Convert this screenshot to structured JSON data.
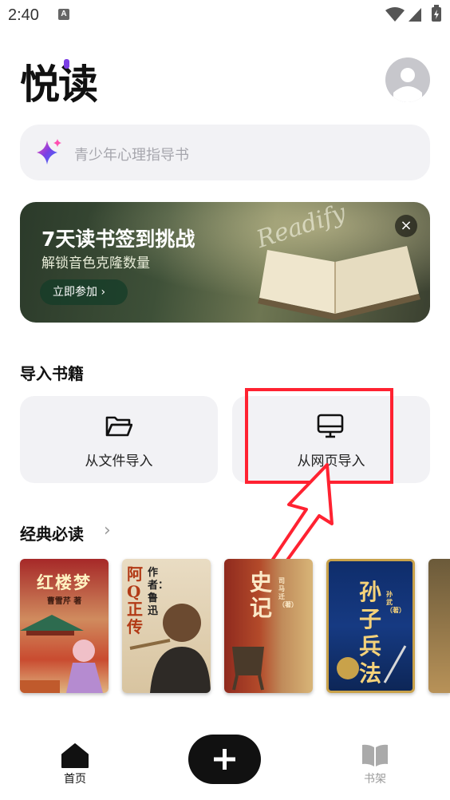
{
  "status_bar": {
    "time": "2:40",
    "notification_icon": "a-letter-icon"
  },
  "header": {
    "logo": "悦读",
    "avatar_icon": "avatar-icon"
  },
  "search": {
    "placeholder": "青少年心理指导书",
    "icon": "sparkle-icon"
  },
  "banner": {
    "title": "7天读书签到挑战",
    "subtitle": "解锁音色克隆数量",
    "button_label": "立即参加 ›",
    "close_label": "×",
    "script_text": "Readify"
  },
  "import": {
    "heading": "导入书籍",
    "file_label": "从文件导入",
    "web_label": "从网页导入"
  },
  "classics": {
    "heading": "经典必读",
    "chevron": "›",
    "books": [
      {
        "title": "红楼梦",
        "author": "曹雪芹 著"
      },
      {
        "title": "阿Q正传",
        "author": "作者：鲁迅"
      },
      {
        "title": "史记",
        "author": "司马迁（著）"
      },
      {
        "title": "孙子兵法",
        "author": "孙武（著）"
      }
    ]
  },
  "bottom_nav": {
    "home_label": "首页",
    "shelf_label": "书架"
  },
  "colors": {
    "annotation": "#ff2231",
    "accent": "#7b3fe4",
    "card_bg": "#f2f2f5"
  }
}
